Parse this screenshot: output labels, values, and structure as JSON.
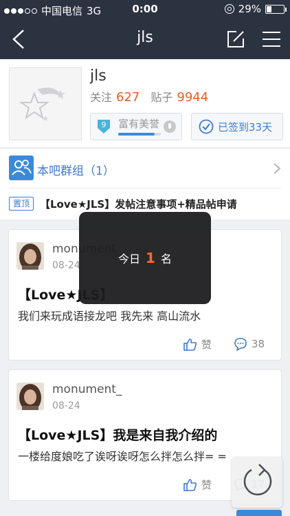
{
  "status_bar": {
    "carrier": "中国电信",
    "network": "3G",
    "time": "0:00",
    "battery": "29%",
    "battery_level": 0.29
  },
  "nav": {
    "title": "jls"
  },
  "header": {
    "name": "jls",
    "follow_label": "关注",
    "follow_count": "627",
    "posts_label": "贴子",
    "posts_count": "9944",
    "level": "9",
    "level_title": "富有美誉",
    "level_progress": 0.85,
    "checkin_label": "已签到33天"
  },
  "group": {
    "label": "本吧群组（1）"
  },
  "pinned": {
    "badge": "置顶",
    "text": "【Love★JLS】发帖注意事项+精品帖申请"
  },
  "toast": {
    "prefix": "今日",
    "rank": "1",
    "suffix": "名"
  },
  "posts": [
    {
      "user": "monument_",
      "date": "08-24",
      "title": "【Love★JLS】",
      "body": "我们来玩成语接龙吧 我先来 高山流水",
      "like_label": "赞",
      "comments": "38"
    },
    {
      "user": "monument_",
      "date": "08-24",
      "title": "【Love★JLS】我是来自我介绍的",
      "body": "一楼给度娘吃了诶呀诶呀怎么拌怎么拌= =",
      "like_label": "赞",
      "comments": "17"
    }
  ],
  "colors": {
    "nav_bg": "#2b3240",
    "accent": "#3b7bd1",
    "count": "#f05a24",
    "toast_rank": "#ff6a2a"
  },
  "icons": {
    "back": "back-icon",
    "edit": "edit-icon",
    "menu": "menu-icon",
    "group": "group-icon",
    "refresh": "refresh-icon"
  }
}
